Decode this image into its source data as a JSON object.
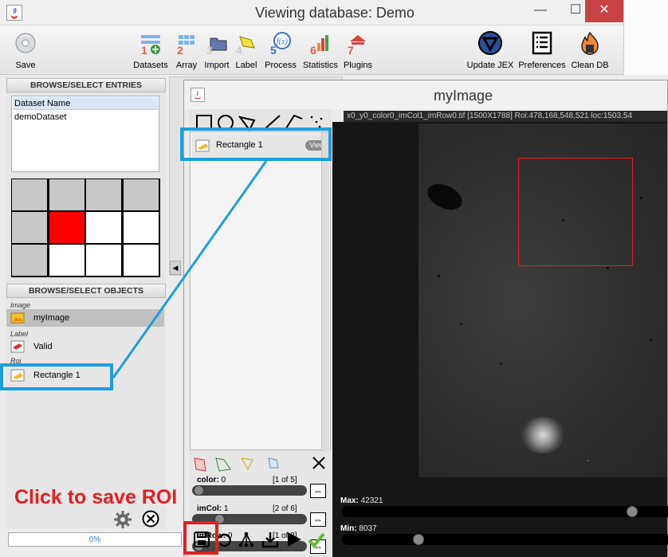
{
  "window": {
    "title": "Viewing database: Demo",
    "buttons": [
      "—",
      "☐",
      "✕"
    ]
  },
  "toolbar": {
    "save_label": "Save",
    "tools": [
      {
        "label": "Datasets",
        "number": "1"
      },
      {
        "label": "Array",
        "number": "2"
      },
      {
        "label": "Import",
        "number": "3"
      },
      {
        "label": "Label",
        "number": "4"
      },
      {
        "label": "Process",
        "number": "5"
      },
      {
        "label": "Statistics",
        "number": "6"
      },
      {
        "label": "Plugins",
        "number": "7"
      }
    ],
    "right_tools": [
      {
        "label": "Update JEX"
      },
      {
        "label": "Preferences"
      },
      {
        "label": "Clean DB"
      }
    ]
  },
  "left": {
    "entries_header": "BROWSE/SELECT ENTRIES",
    "dataset_column": "Dataset Name",
    "dataset_value": "demoDataset",
    "objects_header": "BROWSE/SELECT OBJECTS",
    "categories": {
      "image": "Image",
      "label": "Label",
      "roi": "Roi"
    },
    "objects": {
      "image": "myImage",
      "label": "Valid",
      "roi": "Rectangle 1"
    }
  },
  "image_window": {
    "title": "myImage",
    "info": "x0_y0_color0_imCol1_imRow0.tif   [1500X1788]  Roi:478,168,548,521  loc:1503,54",
    "roi_list_item": "Rectangle 1",
    "view_button": "View",
    "max_label": "Max:",
    "max_value": "42321",
    "min_label": "Min:",
    "min_value": "8037",
    "max_level": 0.88,
    "min_level": 0.22,
    "dims": [
      {
        "name": "color:",
        "value": "0",
        "count": "[1 of 5]"
      },
      {
        "name": "imCol:",
        "value": "1",
        "count": "[2 of 6]"
      },
      {
        "name": "imRow:",
        "value": "0",
        "count": "[1 of 8]"
      }
    ]
  },
  "status": {
    "progress": "0%"
  },
  "annotation": "Click to save ROI",
  "colors": {
    "highlight_blue": "#1e9ed9",
    "annotation_red": "#e02020",
    "roi_red": "#e02020"
  }
}
